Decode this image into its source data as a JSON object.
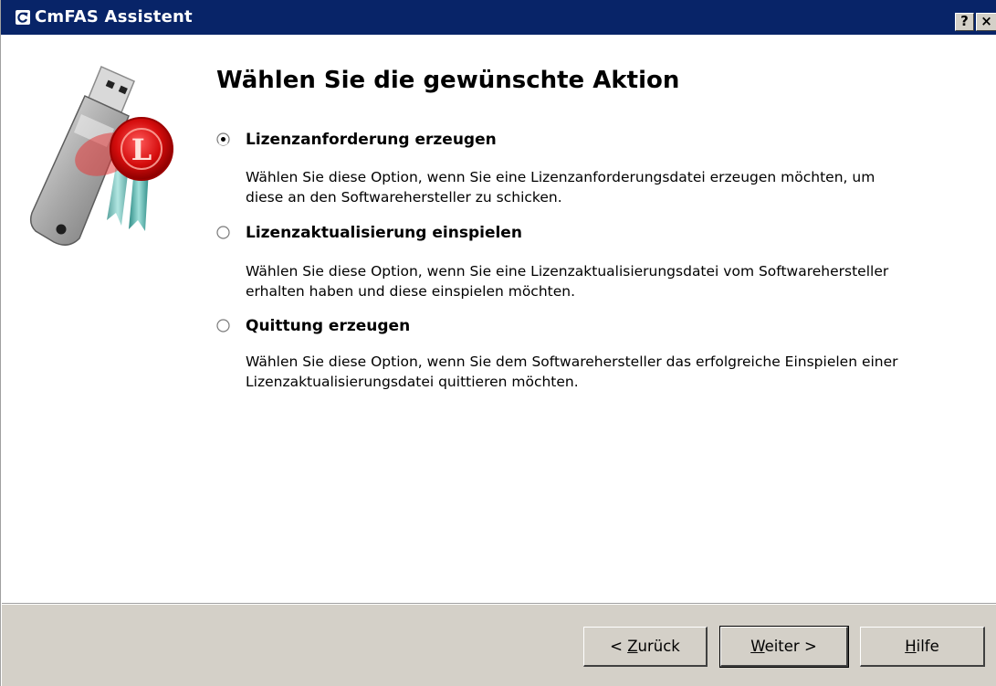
{
  "window": {
    "title": "CmFAS Assistent",
    "help_button": "?",
    "close_button": "×"
  },
  "page": {
    "heading": "Wählen Sie die gewünschte Aktion"
  },
  "options": [
    {
      "label": "Lizenzanforderung erzeugen",
      "selected": true,
      "description": "Wählen Sie diese Option, wenn Sie eine Lizenzanforderungsdatei erzeugen möchten, um\ndiese an den Softwarehersteller zu schicken."
    },
    {
      "label": "Lizenzaktualisierung einspielen",
      "selected": false,
      "description": "Wählen Sie diese Option, wenn Sie eine Lizenzaktualisierungsdatei vom Softwarehersteller\nerhalten haben und diese einspielen möchten."
    },
    {
      "label": "Quittung erzeugen",
      "selected": false,
      "description": "Wählen Sie diese Option, wenn Sie dem Softwarehersteller das erfolgreiche Einspielen einer\nLizenzaktualisierungsdatei quittieren möchten."
    }
  ],
  "buttons": {
    "back_prefix": "< ",
    "back_mnemonic": "Z",
    "back_rest": "urück",
    "next_mnemonic": "W",
    "next_rest": "eiter >",
    "help_mnemonic": "H",
    "help_rest": "ilfe"
  },
  "colors": {
    "titlebar": "#082468",
    "face": "#d4d0c8"
  },
  "icons": {
    "app": "refresh-icon",
    "logo": "usb-dongle-license-seal-icon"
  }
}
